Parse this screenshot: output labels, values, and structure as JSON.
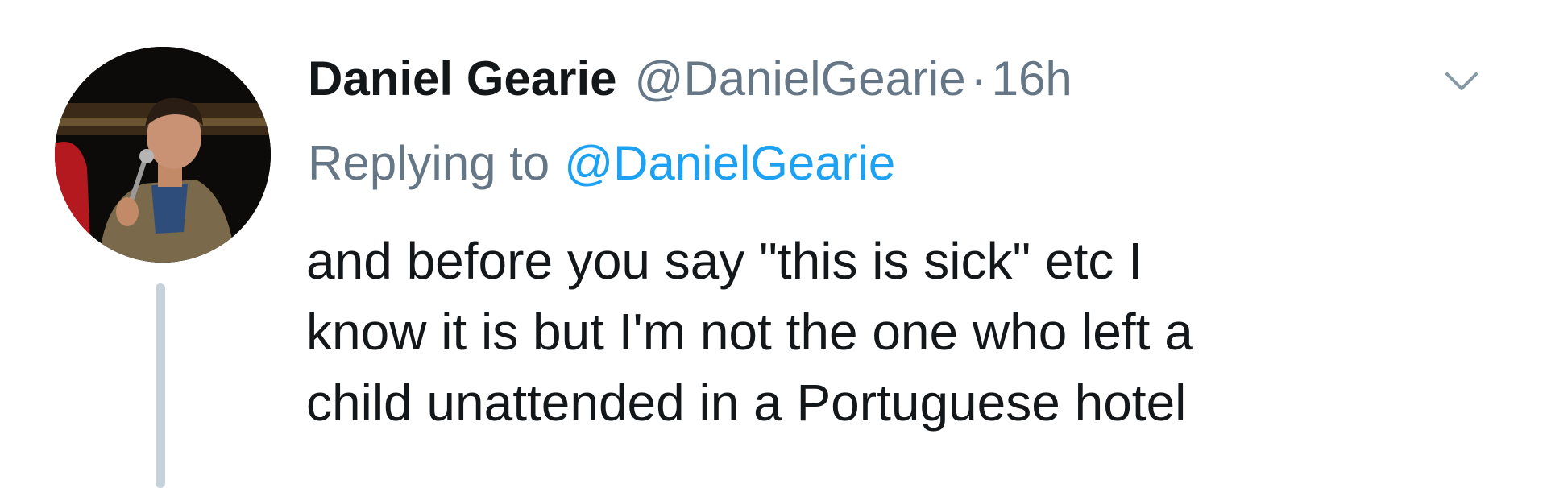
{
  "tweet": {
    "author": {
      "display_name": "Daniel Gearie",
      "handle": "@DanielGearie",
      "separator": "·",
      "time": "16h"
    },
    "replying": {
      "label": "Replying to",
      "target": "@DanielGearie"
    },
    "text_lines": [
      "and before you say \"this is sick\" etc I",
      "know it is but I'm not the one who left a",
      "child unattended in a Portuguese hotel"
    ]
  },
  "icons": {
    "caret": "chevron-down-icon",
    "avatar": "avatar"
  },
  "colors": {
    "name": "#14171a",
    "secondary": "#657786",
    "link": "#1da1f2",
    "thread_line": "#c7d1d9",
    "background": "#ffffff"
  }
}
